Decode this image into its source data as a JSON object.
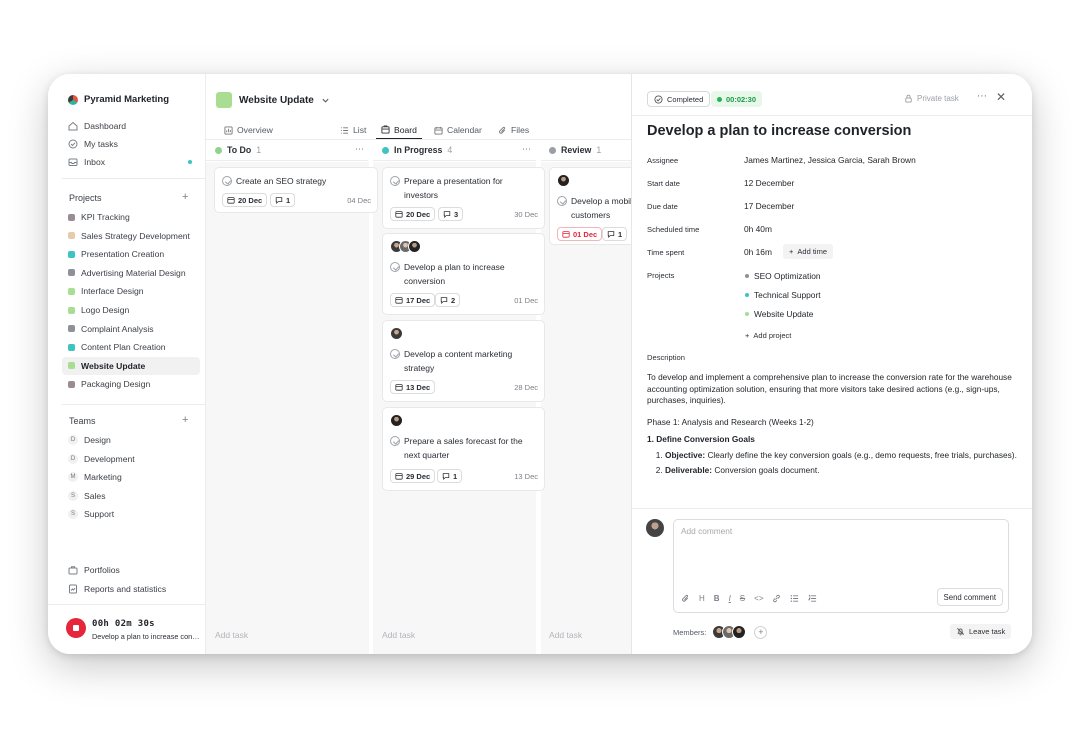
{
  "workspace": {
    "name": "Pyramid Marketing"
  },
  "nav": {
    "dashboard": "Dashboard",
    "my_tasks": "My tasks",
    "inbox": "Inbox"
  },
  "projects": {
    "title": "Projects",
    "add": "+",
    "items": [
      {
        "label": "KPI Tracking",
        "color": "#9b8b94"
      },
      {
        "label": "Sales Strategy Development",
        "color": "#e8ccaa"
      },
      {
        "label": "Presentation Creation",
        "color": "#3ec3c3"
      },
      {
        "label": "Advertising Material Design",
        "color": "#8e9197"
      },
      {
        "label": "Interface Design",
        "color": "#a9dd92"
      },
      {
        "label": "Logo Design",
        "color": "#a9dd92"
      },
      {
        "label": "Complaint Analysis",
        "color": "#8e9197"
      },
      {
        "label": "Content Plan Creation",
        "color": "#3ec3c3"
      },
      {
        "label": "Website Update",
        "color": "#a9dd92"
      },
      {
        "label": "Packaging Design",
        "color": "#9b8b94"
      }
    ]
  },
  "teams": {
    "title": "Teams",
    "add": "+",
    "items": [
      {
        "letter": "D",
        "label": "Design"
      },
      {
        "letter": "D",
        "label": "Development"
      },
      {
        "letter": "M",
        "label": "Marketing"
      },
      {
        "letter": "S",
        "label": "Sales"
      },
      {
        "letter": "S",
        "label": "Support"
      }
    ]
  },
  "footer_nav": {
    "portfolios": "Portfolios",
    "reports": "Reports and statistics"
  },
  "timer": {
    "time": "00h 02m 30s",
    "task": "Develop a plan to increase conversion"
  },
  "board": {
    "project_title": "Website Update",
    "tabs": [
      "Overview",
      "List",
      "Board",
      "Calendar",
      "Files"
    ],
    "columns": [
      {
        "name": "To Do",
        "count": "1",
        "color": "#8fd48a"
      },
      {
        "name": "In Progress",
        "count": "4",
        "color": "#3ec3c3"
      },
      {
        "name": "Review",
        "count": "1",
        "color": "#9a9fa5"
      }
    ],
    "todo_cards": [
      {
        "title": "Create an SEO strategy",
        "chip_date": "20 Dec",
        "comments": "1",
        "date": "04 Dec"
      }
    ],
    "progress_cards": [
      {
        "title": "Prepare a presentation for investors",
        "chip_date": "20 Dec",
        "comments": "3",
        "date": "30 Dec"
      },
      {
        "title": "Develop a plan to increase conversion",
        "chip_date": "17 Dec",
        "comments": "2",
        "date": "01 Dec"
      },
      {
        "title": "Develop a content marketing strategy",
        "chip_date": "13 Dec",
        "date": "28 Dec"
      },
      {
        "title": "Prepare a sales forecast for the next quarter",
        "chip_date": "29 Dec",
        "comments": "1",
        "date": "13 Dec"
      }
    ],
    "review_cards": [
      {
        "title": "Develop a mobile app for customers",
        "chip_date": "01 Dec",
        "comments": "1"
      }
    ],
    "add_task": "Add task"
  },
  "detail": {
    "status": "Completed",
    "time": "00:02:30",
    "private": "Private task",
    "title": "Develop a plan to increase conversion",
    "labels": {
      "assignee": "Assignee",
      "start": "Start date",
      "due": "Due date",
      "scheduled": "Scheduled time",
      "spent": "Time spent",
      "projects": "Projects",
      "description": "Description"
    },
    "assignee": "James Martinez, Jessica Garcia, Sarah Brown",
    "start": "12 December",
    "due": "17 December",
    "scheduled": "0h 40m",
    "spent": "0h 16m",
    "add_time": "Add time",
    "projects": [
      {
        "label": "SEO Optimization",
        "color": "#8e9197"
      },
      {
        "label": "Technical Support",
        "color": "#3ec3c3"
      },
      {
        "label": "Website Update",
        "color": "#a9dd92"
      }
    ],
    "add_project": "Add project",
    "description": {
      "intro": "To develop and implement a comprehensive plan to increase the conversion rate for the warehouse accounting optimization solution, ensuring that more visitors take desired actions (e.g., sign-ups, purchases, inquiries).",
      "phase": "Phase 1: Analysis and Research (Weeks 1-2)",
      "step1": "Define Conversion Goals",
      "objective_label": "Objective:",
      "objective": "Clearly define the key conversion goals (e.g., demo requests, free trials, purchases).",
      "deliverable_label": "Deliverable:",
      "deliverable": "Conversion goals document."
    },
    "comment_placeholder": "Add comment",
    "send": "Send comment",
    "members_label": "Members:",
    "leave": "Leave task"
  }
}
